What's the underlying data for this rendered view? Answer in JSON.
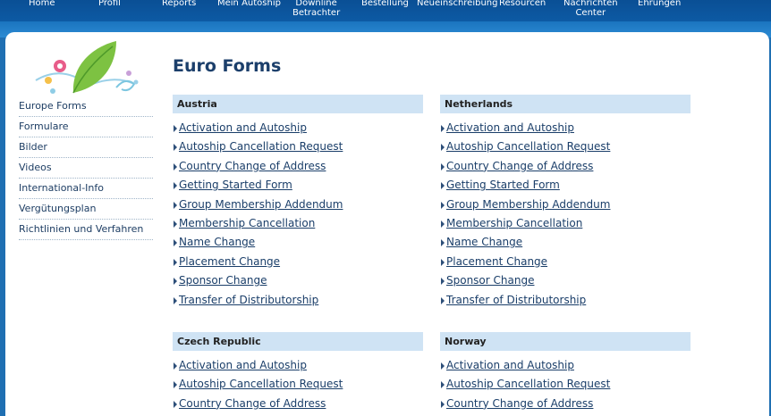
{
  "nav": {
    "items": [
      {
        "label": "Home"
      },
      {
        "label": "Profil"
      },
      {
        "label": "Reports"
      },
      {
        "label": "Mein Autoship"
      },
      {
        "label": "Downline\nBetrachter"
      },
      {
        "label": "Bestellung"
      },
      {
        "label": "Neueinschreibung"
      },
      {
        "label": "Resourcen"
      },
      {
        "label": "Nachrichten\nCenter"
      },
      {
        "label": "Ehrungen"
      }
    ]
  },
  "logo": {
    "icon": "leaf-flower-logo"
  },
  "sidebar": {
    "items": [
      {
        "label": "Europe Forms"
      },
      {
        "label": "Formulare"
      },
      {
        "label": "Bilder"
      },
      {
        "label": "Videos"
      },
      {
        "label": "International-Info"
      },
      {
        "label": "Vergütungsplan"
      },
      {
        "label": "Richtlinien und Verfahren"
      }
    ]
  },
  "page": {
    "title": "Euro Forms"
  },
  "countries": [
    {
      "name": "Austria",
      "forms": [
        "Activation and Autoship",
        "Autoship Cancellation Request",
        "Country Change of Address",
        "Getting Started Form",
        "Group Membership Addendum",
        "Membership Cancellation",
        "Name Change",
        "Placement Change",
        "Sponsor Change",
        "Transfer of Distributorship"
      ]
    },
    {
      "name": "Netherlands",
      "forms": [
        "Activation and Autoship",
        "Autoship Cancellation Request",
        "Country Change of Address",
        "Getting Started Form",
        "Group Membership Addendum",
        "Membership Cancellation",
        "Name Change",
        "Placement Change",
        "Sponsor Change",
        "Transfer of Distributorship"
      ]
    },
    {
      "name": "Czech Republic",
      "forms": [
        "Activation and Autoship",
        "Autoship Cancellation Request",
        "Country Change of Address"
      ]
    },
    {
      "name": "Norway",
      "forms": [
        "Activation and Autoship",
        "Autoship Cancellation Request",
        "Country Change of Address"
      ]
    }
  ],
  "colors": {
    "nav_bg": "#0a4f95",
    "header_bg": "#cfe3f4",
    "link": "#1a3e69"
  }
}
